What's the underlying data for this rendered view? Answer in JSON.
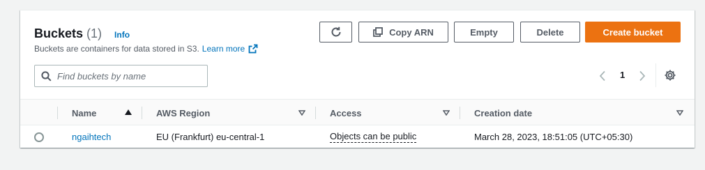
{
  "header": {
    "title": "Buckets",
    "count": "(1)",
    "info": "Info",
    "description": "Buckets are containers for data stored in S3.",
    "learn_more": "Learn more"
  },
  "actions": {
    "refresh_icon": "refresh-icon",
    "copy_arn": "Copy ARN",
    "empty": "Empty",
    "delete": "Delete",
    "create_bucket": "Create bucket"
  },
  "search": {
    "placeholder": "Find buckets by name",
    "value": ""
  },
  "pagination": {
    "current_page": "1"
  },
  "table": {
    "columns": [
      "Name",
      "AWS Region",
      "Access",
      "Creation date"
    ],
    "rows": [
      {
        "name": "ngaihtech",
        "region": "EU (Frankfurt) eu-central-1",
        "access": "Objects can be public",
        "created": "March 28, 2023, 18:51:05 (UTC+05:30)"
      }
    ]
  },
  "colors": {
    "accent": "#ec7211",
    "link": "#0073bb",
    "text": "#16191f",
    "muted": "#545b64"
  }
}
